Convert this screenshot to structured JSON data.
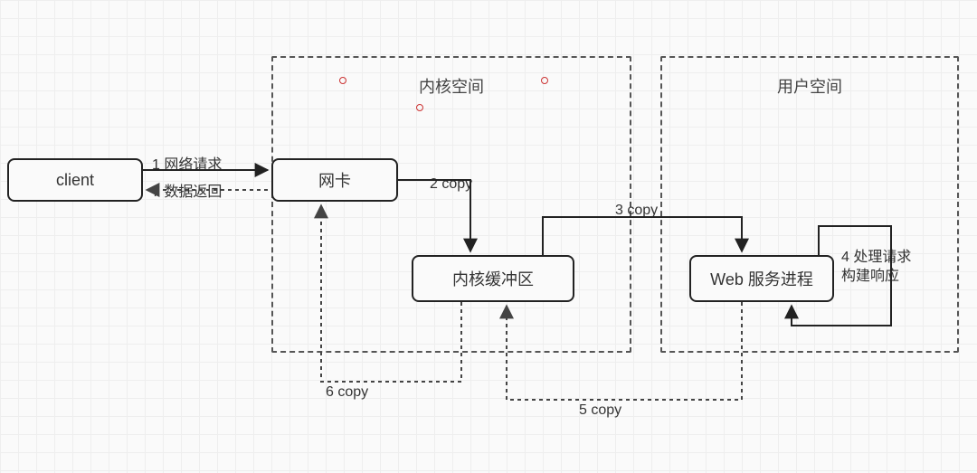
{
  "containers": {
    "kernel": {
      "label": "内核空间"
    },
    "user": {
      "label": "用户空间"
    }
  },
  "nodes": {
    "client": {
      "label": "client"
    },
    "nic": {
      "label": "网卡"
    },
    "kbuf": {
      "label": "内核缓冲区"
    },
    "webproc": {
      "label": "Web 服务进程"
    }
  },
  "edges": {
    "e1": {
      "label": "1 网络请求"
    },
    "e2": {
      "label": "2 copy"
    },
    "e3": {
      "label": "3 copy"
    },
    "e4": {
      "label": "4 处理请求\n构建响应"
    },
    "e5": {
      "label": "5 copy"
    },
    "e6": {
      "label": "6 copy"
    },
    "e7": {
      "label": "7 数据返回"
    }
  }
}
